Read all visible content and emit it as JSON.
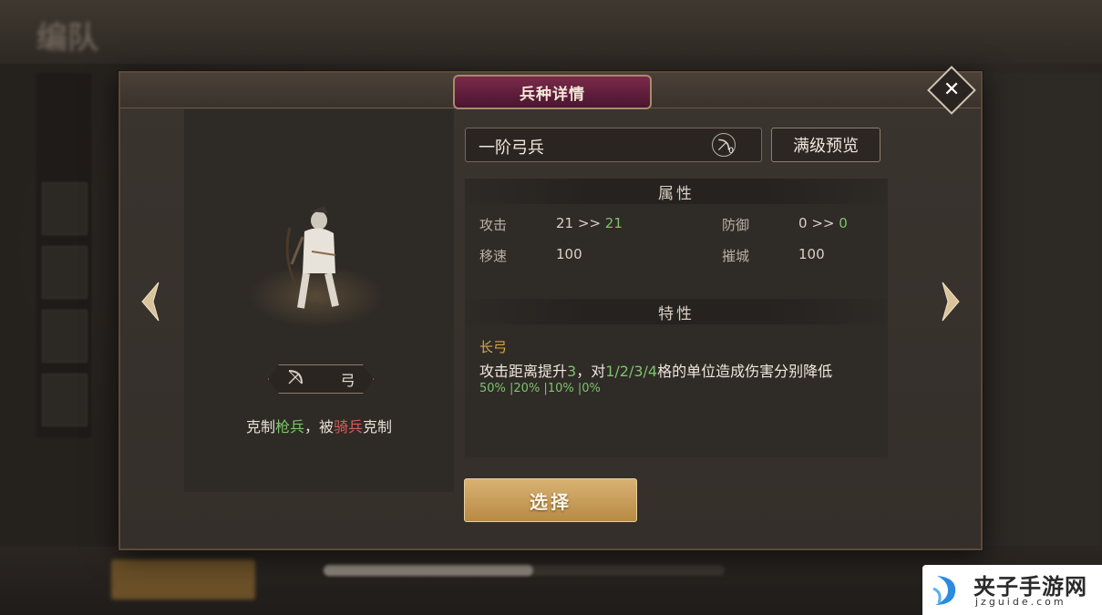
{
  "background": {
    "top_title": "编队"
  },
  "dialog": {
    "title": "兵种详情",
    "close_icon": "close-icon"
  },
  "unit": {
    "type_icon": "bow-icon",
    "type_label": "弓",
    "counter": {
      "prefix": "克制",
      "counters": "枪兵",
      "middle": "，被",
      "countered_by": "骑兵",
      "suffix": "克制"
    }
  },
  "name_box": {
    "name": "一阶弓兵",
    "icon": "bow-icon",
    "icon_count": "0"
  },
  "preview_button": "满级预览",
  "attributes": {
    "header": "属性",
    "items": [
      {
        "label": "攻击",
        "base": "21",
        "arrow": ">>",
        "next": "21"
      },
      {
        "label": "防御",
        "base": "0",
        "arrow": ">>",
        "next": "0"
      },
      {
        "label": "移速",
        "value": "100"
      },
      {
        "label": "摧城",
        "value": "100"
      }
    ]
  },
  "traits": {
    "header": "特性",
    "name": "长弓",
    "desc_1": "攻击距离提升",
    "desc_num": "3",
    "desc_2": "，对",
    "desc_grids": "1/2/3/4",
    "desc_3": "格的单位造成伤害分别降低",
    "values": "50% |20% |10% |0%"
  },
  "select_button": "选择",
  "watermark": {
    "title": "夹子手游网",
    "url": "jzguide.com"
  },
  "colors": {
    "accent_gold": "#d8b273",
    "title_plate": "#7a2a4a",
    "positive": "#7cc46a",
    "negative": "#d85b5b",
    "trait_name": "#d7a64a"
  }
}
